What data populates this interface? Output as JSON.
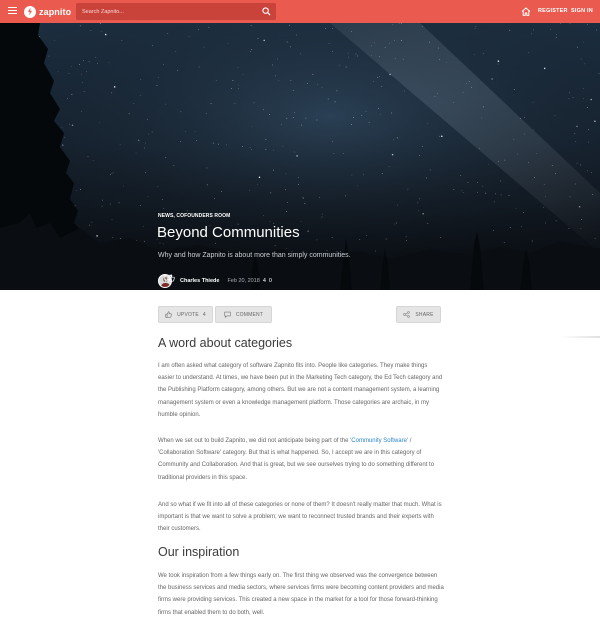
{
  "topbar": {
    "brand": "zapnito",
    "search_placeholder": "Search Zapnito...",
    "register_label": "REGISTER",
    "signin_label": "SIGN IN",
    "accent_color": "#ea5a4f"
  },
  "hero": {
    "categories": "NEWS, COFOUNDERS ROOM",
    "title": "Beyond Communities",
    "subtitle": "Why and how Zapnito is about more than simply communities.",
    "author": "Charles Thiede",
    "date": "Feb 20, 2018",
    "likes": "4",
    "comments": "0"
  },
  "actions": {
    "upvote_label": "UPVOTE",
    "upvote_count": "4",
    "comment_label": "COMMENT",
    "share_label": "SHARE"
  },
  "article": {
    "heading1": "A word about categories",
    "para1": "I am often asked what category of software Zapnito fits into. People like categories. They make things easier to understand. At times, we have been put in the Marketing Tech category, the Ed Tech category and the Publishing Platform category, among others. But we are not a content management system, a learning management system or even a knowledge management platform. Those categories are archaic, in my humble opinion.",
    "para2_before": "When we set out to build Zapnito, we did not anticipate being part of the ",
    "para2_link": "'Community Software'",
    "para2_after": " / 'Collaboration Software' category. But that is what happened. So, I accept we are in this category of Community and Collaboration. And that is great, but we see ourselves trying to do something different to traditional providers in this space.",
    "para3": "And so what if we fit into all of these categories or none of them? It doesn't really matter that much. What is important is that we want to solve a problem; we want to reconnect trusted brands and their experts with their customers.",
    "heading2": "Our inspiration",
    "para4": "We took inspiration from a few things early on. The first thing we observed was the convergence between the business services and media sectors, where services firms were becoming content providers and media firms were providing services. This created a new space in the market for a tool for those forward-thinking firms that enabled them to do both, well."
  }
}
